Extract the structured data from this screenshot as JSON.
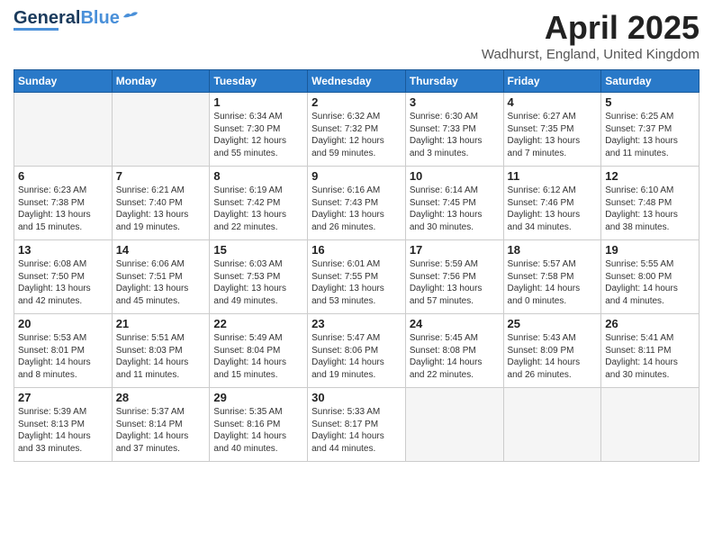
{
  "header": {
    "logo_general": "General",
    "logo_blue": "Blue",
    "month": "April 2025",
    "location": "Wadhurst, England, United Kingdom"
  },
  "days_of_week": [
    "Sunday",
    "Monday",
    "Tuesday",
    "Wednesday",
    "Thursday",
    "Friday",
    "Saturday"
  ],
  "weeks": [
    [
      {
        "day": "",
        "info": ""
      },
      {
        "day": "",
        "info": ""
      },
      {
        "day": "1",
        "info": "Sunrise: 6:34 AM\nSunset: 7:30 PM\nDaylight: 12 hours\nand 55 minutes."
      },
      {
        "day": "2",
        "info": "Sunrise: 6:32 AM\nSunset: 7:32 PM\nDaylight: 12 hours\nand 59 minutes."
      },
      {
        "day": "3",
        "info": "Sunrise: 6:30 AM\nSunset: 7:33 PM\nDaylight: 13 hours\nand 3 minutes."
      },
      {
        "day": "4",
        "info": "Sunrise: 6:27 AM\nSunset: 7:35 PM\nDaylight: 13 hours\nand 7 minutes."
      },
      {
        "day": "5",
        "info": "Sunrise: 6:25 AM\nSunset: 7:37 PM\nDaylight: 13 hours\nand 11 minutes."
      }
    ],
    [
      {
        "day": "6",
        "info": "Sunrise: 6:23 AM\nSunset: 7:38 PM\nDaylight: 13 hours\nand 15 minutes."
      },
      {
        "day": "7",
        "info": "Sunrise: 6:21 AM\nSunset: 7:40 PM\nDaylight: 13 hours\nand 19 minutes."
      },
      {
        "day": "8",
        "info": "Sunrise: 6:19 AM\nSunset: 7:42 PM\nDaylight: 13 hours\nand 22 minutes."
      },
      {
        "day": "9",
        "info": "Sunrise: 6:16 AM\nSunset: 7:43 PM\nDaylight: 13 hours\nand 26 minutes."
      },
      {
        "day": "10",
        "info": "Sunrise: 6:14 AM\nSunset: 7:45 PM\nDaylight: 13 hours\nand 30 minutes."
      },
      {
        "day": "11",
        "info": "Sunrise: 6:12 AM\nSunset: 7:46 PM\nDaylight: 13 hours\nand 34 minutes."
      },
      {
        "day": "12",
        "info": "Sunrise: 6:10 AM\nSunset: 7:48 PM\nDaylight: 13 hours\nand 38 minutes."
      }
    ],
    [
      {
        "day": "13",
        "info": "Sunrise: 6:08 AM\nSunset: 7:50 PM\nDaylight: 13 hours\nand 42 minutes."
      },
      {
        "day": "14",
        "info": "Sunrise: 6:06 AM\nSunset: 7:51 PM\nDaylight: 13 hours\nand 45 minutes."
      },
      {
        "day": "15",
        "info": "Sunrise: 6:03 AM\nSunset: 7:53 PM\nDaylight: 13 hours\nand 49 minutes."
      },
      {
        "day": "16",
        "info": "Sunrise: 6:01 AM\nSunset: 7:55 PM\nDaylight: 13 hours\nand 53 minutes."
      },
      {
        "day": "17",
        "info": "Sunrise: 5:59 AM\nSunset: 7:56 PM\nDaylight: 13 hours\nand 57 minutes."
      },
      {
        "day": "18",
        "info": "Sunrise: 5:57 AM\nSunset: 7:58 PM\nDaylight: 14 hours\nand 0 minutes."
      },
      {
        "day": "19",
        "info": "Sunrise: 5:55 AM\nSunset: 8:00 PM\nDaylight: 14 hours\nand 4 minutes."
      }
    ],
    [
      {
        "day": "20",
        "info": "Sunrise: 5:53 AM\nSunset: 8:01 PM\nDaylight: 14 hours\nand 8 minutes."
      },
      {
        "day": "21",
        "info": "Sunrise: 5:51 AM\nSunset: 8:03 PM\nDaylight: 14 hours\nand 11 minutes."
      },
      {
        "day": "22",
        "info": "Sunrise: 5:49 AM\nSunset: 8:04 PM\nDaylight: 14 hours\nand 15 minutes."
      },
      {
        "day": "23",
        "info": "Sunrise: 5:47 AM\nSunset: 8:06 PM\nDaylight: 14 hours\nand 19 minutes."
      },
      {
        "day": "24",
        "info": "Sunrise: 5:45 AM\nSunset: 8:08 PM\nDaylight: 14 hours\nand 22 minutes."
      },
      {
        "day": "25",
        "info": "Sunrise: 5:43 AM\nSunset: 8:09 PM\nDaylight: 14 hours\nand 26 minutes."
      },
      {
        "day": "26",
        "info": "Sunrise: 5:41 AM\nSunset: 8:11 PM\nDaylight: 14 hours\nand 30 minutes."
      }
    ],
    [
      {
        "day": "27",
        "info": "Sunrise: 5:39 AM\nSunset: 8:13 PM\nDaylight: 14 hours\nand 33 minutes."
      },
      {
        "day": "28",
        "info": "Sunrise: 5:37 AM\nSunset: 8:14 PM\nDaylight: 14 hours\nand 37 minutes."
      },
      {
        "day": "29",
        "info": "Sunrise: 5:35 AM\nSunset: 8:16 PM\nDaylight: 14 hours\nand 40 minutes."
      },
      {
        "day": "30",
        "info": "Sunrise: 5:33 AM\nSunset: 8:17 PM\nDaylight: 14 hours\nand 44 minutes."
      },
      {
        "day": "",
        "info": ""
      },
      {
        "day": "",
        "info": ""
      },
      {
        "day": "",
        "info": ""
      }
    ]
  ]
}
